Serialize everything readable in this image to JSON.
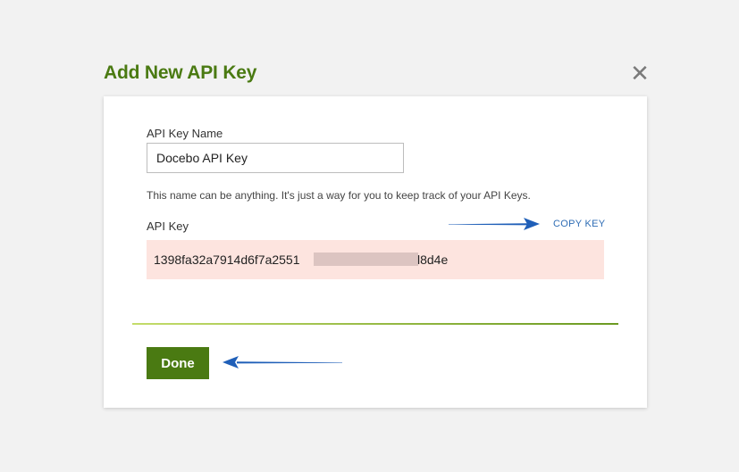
{
  "dialog": {
    "title": "Add New API Key",
    "close_icon": "close-icon",
    "close_glyph": "✕"
  },
  "form": {
    "name_label": "API Key Name",
    "name_value": "Docebo API Key",
    "help_text": "This name can be anything. It's just a way for you to keep track of your API Keys.",
    "key_label": "API Key",
    "copy_key_label": "COPY KEY",
    "key_prefix": "1398fa32a7914d6f7a2551",
    "key_suffix": "l8d4e"
  },
  "footer": {
    "done_label": "Done"
  },
  "colors": {
    "title": "#4a7a12",
    "done_button": "#4a7a12",
    "copy_link": "#2f6db5",
    "key_box_bg": "#fde4df",
    "annotation_arrow": "#1f5fb8",
    "page_bg": "#f2f2f2"
  }
}
